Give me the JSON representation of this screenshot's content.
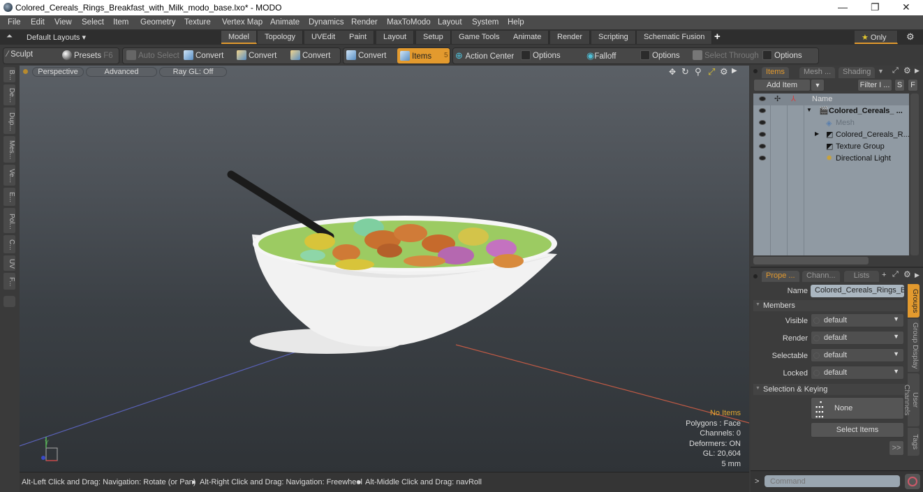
{
  "window": {
    "title": "Colored_Cereals_Rings_Breakfast_with_Milk_modo_base.lxo* - MODO",
    "minimize": "—",
    "restore": "❐",
    "close": "✕"
  },
  "menu": [
    "File",
    "Edit",
    "View",
    "Select",
    "Item",
    "Geometry",
    "Texture",
    "Vertex Map",
    "Animate",
    "Dynamics",
    "Render",
    "MaxToModo",
    "Layout",
    "System",
    "Help"
  ],
  "layouts": {
    "dropdown": "Default Layouts ▾",
    "tabs": [
      "Model",
      "Topology",
      "UVEdit",
      "Paint",
      "Layout",
      "Setup",
      "Game Tools",
      "Animate",
      "Render",
      "Scripting",
      "Schematic Fusion"
    ],
    "active": "Model",
    "add": "+",
    "only": "Only"
  },
  "toolbar": {
    "sculpt": "Sculpt",
    "presets": "Presets",
    "presets_key": "F6",
    "auto_select": "Auto Select",
    "convert1": "Convert",
    "convert2": "Convert",
    "convert3": "Convert",
    "convert4": "Convert",
    "items": "Items",
    "items_key": "5",
    "action_center": "Action Center",
    "options1": "Options",
    "falloff": "Falloff",
    "options2": "Options",
    "select_through": "Select Through",
    "options3": "Options"
  },
  "left_tabs": [
    "B...",
    "De...",
    "Dup...",
    "Mes...",
    "Ve...",
    "E...",
    "Pol...",
    "C...",
    "UV",
    "F..."
  ],
  "viewport": {
    "perspective": "Perspective",
    "advanced": "Advanced",
    "raygl": "Ray GL: Off",
    "info": {
      "selection": "No Items",
      "polygons": "Polygons : Face",
      "channels": "Channels: 0",
      "deformers": "Deformers: ON",
      "gl": "GL: 20,604",
      "scale": "5 mm"
    },
    "axis_label": "Y"
  },
  "status": {
    "hint1": "Alt-Left Click and Drag: Navigation: Rotate (or Pan)",
    "hint2": "Alt-Right Click and Drag: Navigation: Freewheel",
    "hint3": "Alt-Middle Click and Drag: navRoll"
  },
  "items_panel": {
    "tabs": [
      "Items",
      "Mesh ...",
      "Shading"
    ],
    "add_item": "Add Item",
    "filter": "Filter I ...",
    "s": "S",
    "f": "F",
    "col_name": "Name",
    "rows": [
      {
        "name": "Colored_Cereals_ ...",
        "bold": true
      },
      {
        "name": "Mesh",
        "dim": true
      },
      {
        "name": "Colored_Cereals_R..."
      },
      {
        "name": "Texture Group"
      },
      {
        "name": "Directional Light"
      }
    ]
  },
  "properties": {
    "tabs": [
      "Prope ...",
      "Chann...",
      "Lists"
    ],
    "add": "+",
    "name_label": "Name",
    "name_value": "Colored_Cereals_Rings_Br",
    "members": "Members",
    "fields": [
      {
        "label": "Visible",
        "value": "default"
      },
      {
        "label": "Render",
        "value": "default"
      },
      {
        "label": "Selectable",
        "value": "default"
      },
      {
        "label": "Locked",
        "value": "default"
      }
    ],
    "sel_keying": "Selection & Keying",
    "none": "None",
    "select_items": "Select Items",
    "more": ">>",
    "side_tabs": [
      "Groups",
      "Group Display",
      "User Channels",
      "Tags"
    ]
  },
  "command": {
    "prompt": ">",
    "placeholder": "Command"
  }
}
